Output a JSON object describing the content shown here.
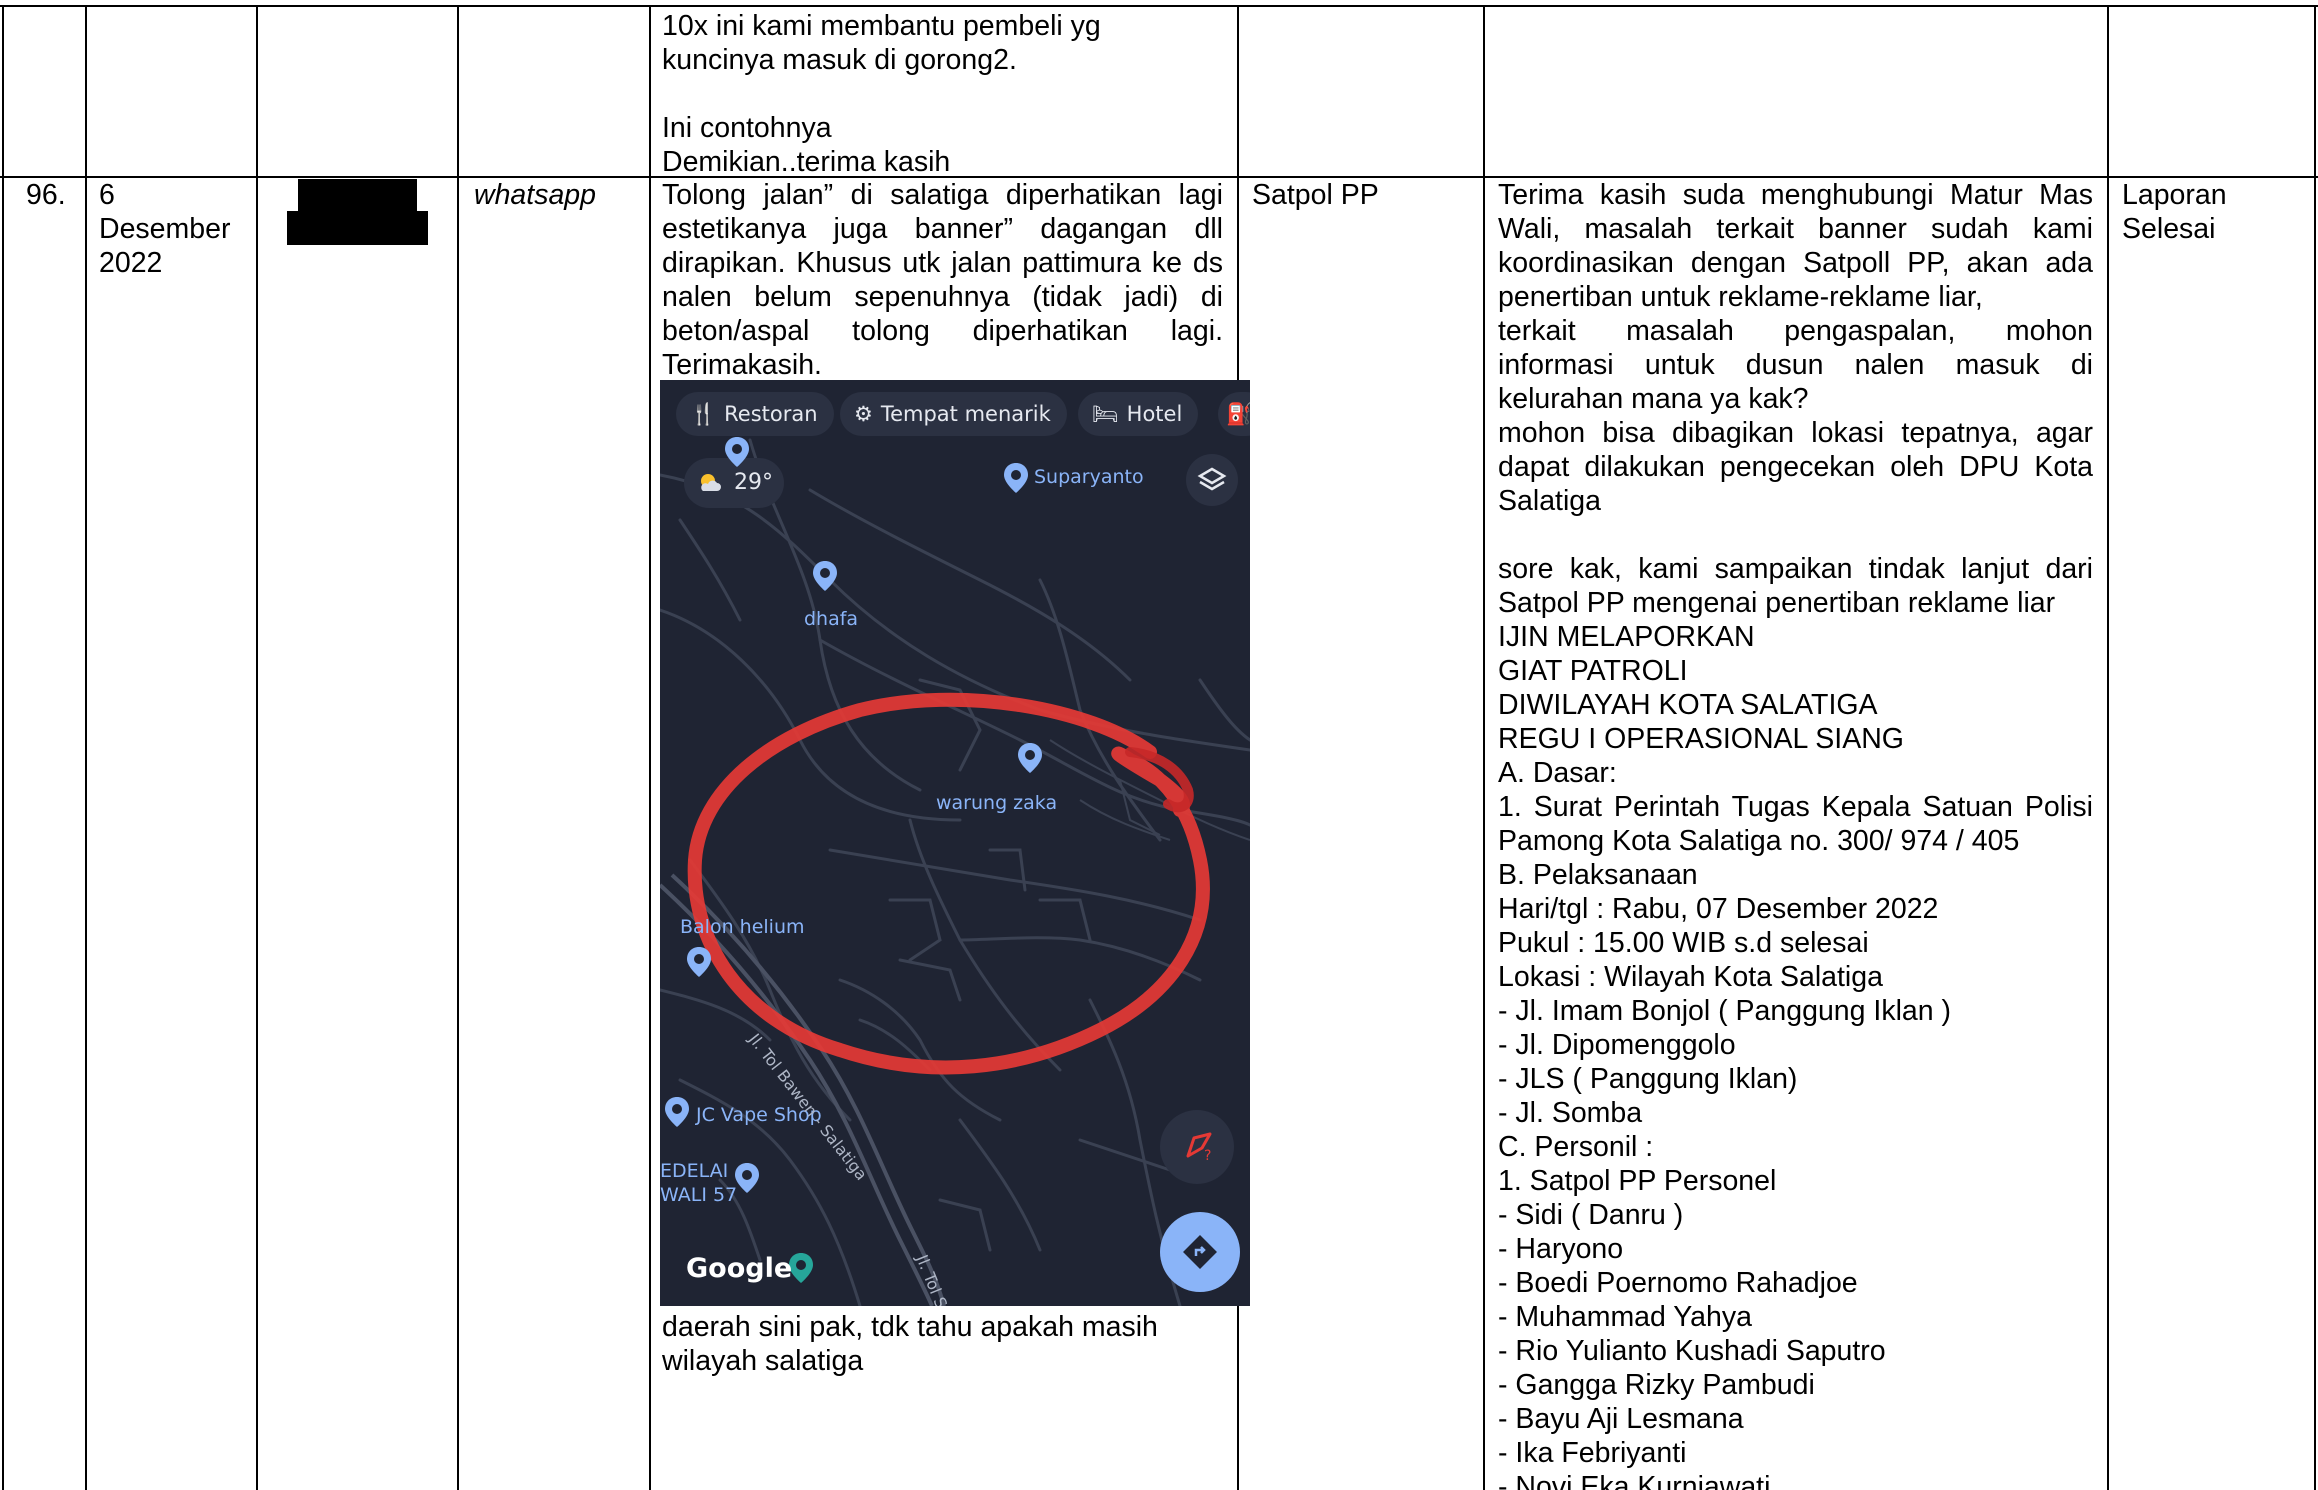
{
  "top_row": {
    "complaint_lines": [
      "10x ini kami membantu pembeli yg",
      "kuncinya masuk di gorong2.",
      "",
      "Ini contohnya",
      "Demikian..terima kasih"
    ]
  },
  "row": {
    "number": "96.",
    "date_lines": [
      "6",
      "Desember",
      "2022"
    ],
    "channel": "whatsapp",
    "complaint_lines": [
      "Tolong jalan” di salatiga diperhatikan lagi",
      "estetikanya juga banner” dagangan dll",
      "dirapikan. Khusus utk jalan pattimura ke ds",
      "nalen belum sepenuhnya (tidak jadi) di",
      "beton/aspal tolong diperhatikan lagi.",
      "Terimakasih."
    ],
    "complaint_after_lines": [
      "daerah sini pak, tdk tahu apakah masih",
      "wilayah salatiga"
    ],
    "agency": "Satpol PP",
    "response_lines": [
      "Terima kasih suda menghubungi Matur Mas",
      "Wali, masalah terkait banner sudah kami",
      "koordinasikan dengan Satpoll PP, akan ada",
      "penertiban untuk reklame-reklame liar,",
      "terkait masalah pengaspalan, mohon",
      "informasi untuk dusun nalen masuk di",
      "kelurahan mana ya kak?",
      "mohon bisa dibagikan lokasi tepatnya, agar",
      "dapat dilakukan pengecekan oleh DPU Kota",
      "Salatiga",
      "",
      "sore kak, kami sampaikan tindak lanjut dari",
      "Satpol PP mengenai penertiban reklame liar",
      "IJIN MELAPORKAN",
      "GIAT PATROLI",
      "DIWILAYAH KOTA SALATIGA",
      "REGU I OPERASIONAL SIANG",
      "A. Dasar:",
      "1. Surat Perintah Tugas Kepala Satuan Polisi",
      "Pamong Kota Salatiga no. 300/ 974 / 405",
      "B. Pelaksanaan",
      "Hari/tgl : Rabu, 07 Desember 2022",
      "Pukul : 15.00 WIB s.d selesai",
      "Lokasi : Wilayah Kota Salatiga",
      "- Jl. Imam Bonjol ( Panggung Iklan )",
      "- Jl. Dipomenggolo",
      "- JLS ( Panggung Iklan)",
      "- Jl. Somba",
      "C. Personil :",
      "1. Satpol PP Personel",
      "- Sidi ( Danru )",
      "- Haryono",
      "- Boedi Poernomo Rahadjoe",
      "- Muhammad Yahya",
      "- Rio Yulianto Kushadi Saputro",
      "- Gangga Rizky Pambudi",
      "- Bayu Aji Lesmana",
      "- Ika Febriyanti",
      "- Novi Eka Kurniawati"
    ],
    "status_lines": [
      "Laporan",
      "Selesai"
    ]
  },
  "map": {
    "chips": [
      "Restoran",
      "Tempat menarik",
      "Hotel"
    ],
    "chip_icons": [
      "fork-knife-icon",
      "attraction-icon",
      "bed-icon",
      "fuel-icon"
    ],
    "temperature": "29°",
    "places": [
      "Suparyanto",
      "dhafa",
      "warung zaka",
      "Balon helium",
      "JC Vape Shop",
      "EDELAI",
      "WALI 57"
    ],
    "roads": [
      "Jl. Tol Bawen - Salatiga",
      "Jl. Tol Se"
    ],
    "brand": "Google",
    "colors": {
      "background": "#1f2433",
      "road": "#3a4152",
      "highlight": "#e53935",
      "accent": "#8ab4f8"
    }
  }
}
